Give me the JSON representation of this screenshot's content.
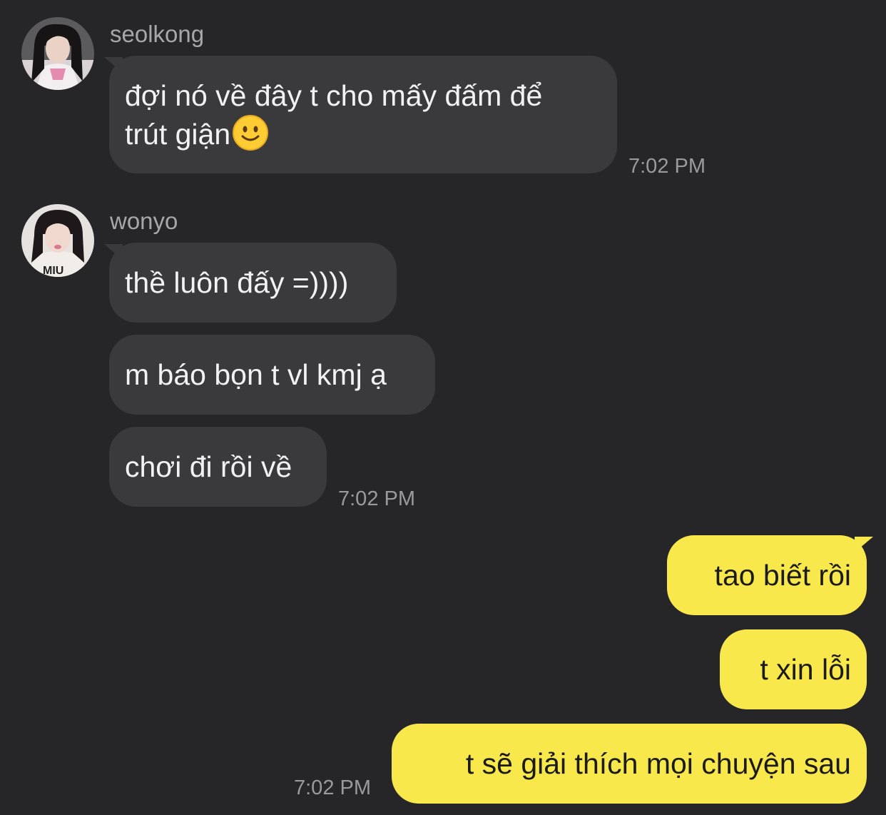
{
  "messages": {
    "group1": {
      "sender": "seolkong",
      "avatar": "seolkong-avatar",
      "line1": "đợi nó về đây t cho mấy đấm để",
      "line2": "trút giận",
      "emoji": "slightly-smiling-face-icon",
      "time": "7:02 PM"
    },
    "group2": {
      "sender": "wonyo",
      "avatar": "wonyo-avatar",
      "bubbles": [
        "thề luôn đấy =))))",
        "m báo bọn t vl kmj ạ",
        "chơi đi rồi về"
      ],
      "time": "7:02 PM"
    },
    "mine": {
      "bubbles": [
        "tao biết rồi",
        "t xin lỗi",
        "t sẽ giải thích mọi chuyện sau"
      ],
      "time": "7:02 PM"
    }
  },
  "colors": {
    "background": "#262628",
    "incoming_bubble": "#3a3a3c",
    "outgoing_bubble": "#f9e84b",
    "sender_text": "#a7a7ab",
    "timestamp": "#9a9a9e"
  }
}
